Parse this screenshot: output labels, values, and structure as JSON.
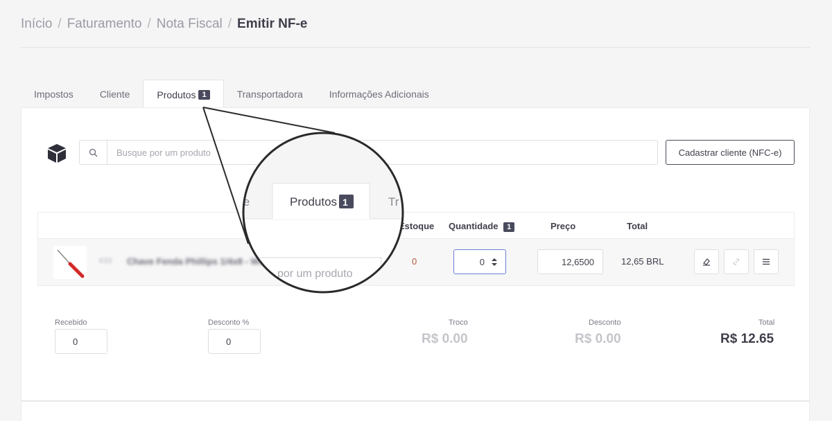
{
  "breadcrumb": {
    "items": [
      "Início",
      "Faturamento",
      "Nota Fiscal"
    ],
    "current": "Emitir NF-e",
    "separator": "/"
  },
  "tabs": [
    {
      "label": "Impostos"
    },
    {
      "label": "Cliente"
    },
    {
      "label": "Produtos",
      "badge": "1",
      "active": true
    },
    {
      "label": "Transportadora"
    },
    {
      "label": "Informações Adicionais"
    }
  ],
  "search": {
    "placeholder": "Busque por um produto"
  },
  "register_button": "Cadastrar cliente (NFC-e)",
  "table": {
    "headers": {
      "estoque": "Estoque",
      "quantidade": "Quantidade",
      "quantidade_badge": "1",
      "preco": "Preço",
      "total": "Total"
    },
    "row": {
      "code": "633",
      "name": "Chave Fenda Phillips 1/4x8 - Wd",
      "stock": "0",
      "quantity": "0",
      "price": "12,6500",
      "total": "12,65 BRL"
    }
  },
  "summary": {
    "recebido_label": "Recebido",
    "recebido_value": "0",
    "desconto_pct_label": "Desconto %",
    "desconto_pct_value": "0",
    "troco_label": "Troco",
    "troco_value": "R$ 0.00",
    "desconto_label": "Desconto",
    "desconto_value": "R$ 0.00",
    "total_label": "Total",
    "total_value": "R$ 12.65"
  },
  "zoom": {
    "tab_left": "te",
    "tab_label": "Produtos",
    "tab_badge": "1",
    "tab_right": "Tr",
    "search_fragment": "por um produto"
  },
  "colors": {
    "badge": "#4a4a5e",
    "accent_input": "#6b7fd3",
    "stock": "#b35a3a"
  }
}
